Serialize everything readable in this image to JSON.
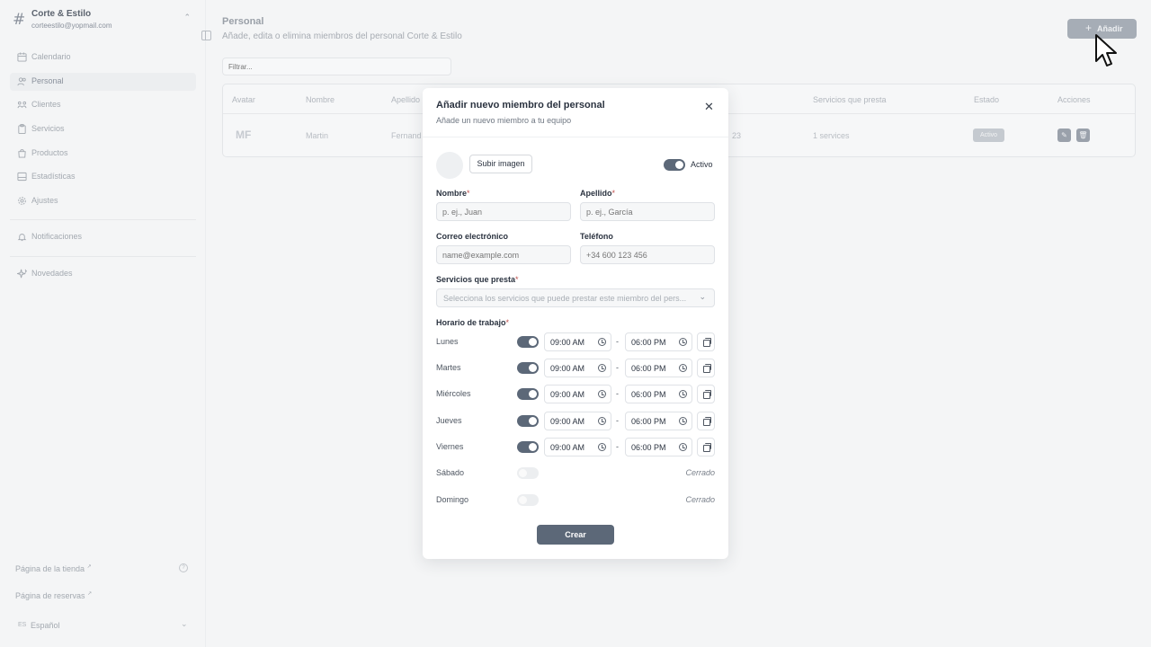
{
  "brand": {
    "name": "Corte & Estilo",
    "email": "corteestilo@yopmail.com"
  },
  "sidebar": {
    "items": [
      {
        "label": "Calendario",
        "icon": "calendar-icon"
      },
      {
        "label": "Personal",
        "icon": "users-icon",
        "active": true
      },
      {
        "label": "Clientes",
        "icon": "clients-icon"
      },
      {
        "label": "Servicios",
        "icon": "clipboard-icon"
      },
      {
        "label": "Productos",
        "icon": "shopping-bag-icon"
      },
      {
        "label": "Estadísticas",
        "icon": "chart-icon"
      },
      {
        "label": "Ajustes",
        "icon": "gear-icon"
      }
    ],
    "notifications": "Notificaciones",
    "news": "Novedades",
    "store_page": "Página de la tienda",
    "booking_page": "Página de reservas",
    "lang_code": "ES",
    "language": "Español"
  },
  "page": {
    "title": "Personal",
    "subtitle": "Añade, edita o elimina miembros del personal Corte & Estilo",
    "add_label": "Añadir",
    "filter_placeholder": "Filtrar..."
  },
  "table": {
    "headers": [
      "Avatar",
      "Nombre",
      "Apellido",
      "Servicios que presta",
      "Estado",
      "Acciones"
    ],
    "row": {
      "initials": "MF",
      "name": "Martin",
      "surname": "Fernand",
      "phone_tail": "23",
      "services": "1 services",
      "status": "Activo"
    }
  },
  "modal": {
    "title": "Añadir nuevo miembro del personal",
    "subtitle": "Añade un nuevo miembro a tu equipo",
    "upload_label": "Subir imagen",
    "active_label": "Activo",
    "first_name_label": "Nombre",
    "first_name_placeholder": "p. ej., Juan",
    "last_name_label": "Apellido",
    "last_name_placeholder": "p. ej., García",
    "email_label": "Correo electrónico",
    "email_placeholder": "name@example.com",
    "phone_label": "Teléfono",
    "phone_placeholder": "+34 600 123 456",
    "services_label": "Servicios que presta",
    "services_placeholder": "Selecciona los servicios que puede prestar este miembro del pers...",
    "schedule_label": "Horario de trabajo",
    "required_mark": "*",
    "dash": "-",
    "days": [
      {
        "name": "Lunes",
        "enabled": true,
        "start": "09:00 AM",
        "end": "06:00 PM"
      },
      {
        "name": "Martes",
        "enabled": true,
        "start": "09:00 AM",
        "end": "06:00 PM"
      },
      {
        "name": "Miércoles",
        "enabled": true,
        "start": "09:00 AM",
        "end": "06:00 PM"
      },
      {
        "name": "Jueves",
        "enabled": true,
        "start": "09:00 AM",
        "end": "06:00 PM"
      },
      {
        "name": "Viernes",
        "enabled": true,
        "start": "09:00 AM",
        "end": "06:00 PM"
      },
      {
        "name": "Sábado",
        "enabled": false,
        "closed": "Cerrado"
      },
      {
        "name": "Domingo",
        "enabled": false,
        "closed": "Cerrado"
      }
    ],
    "create_label": "Crear"
  }
}
